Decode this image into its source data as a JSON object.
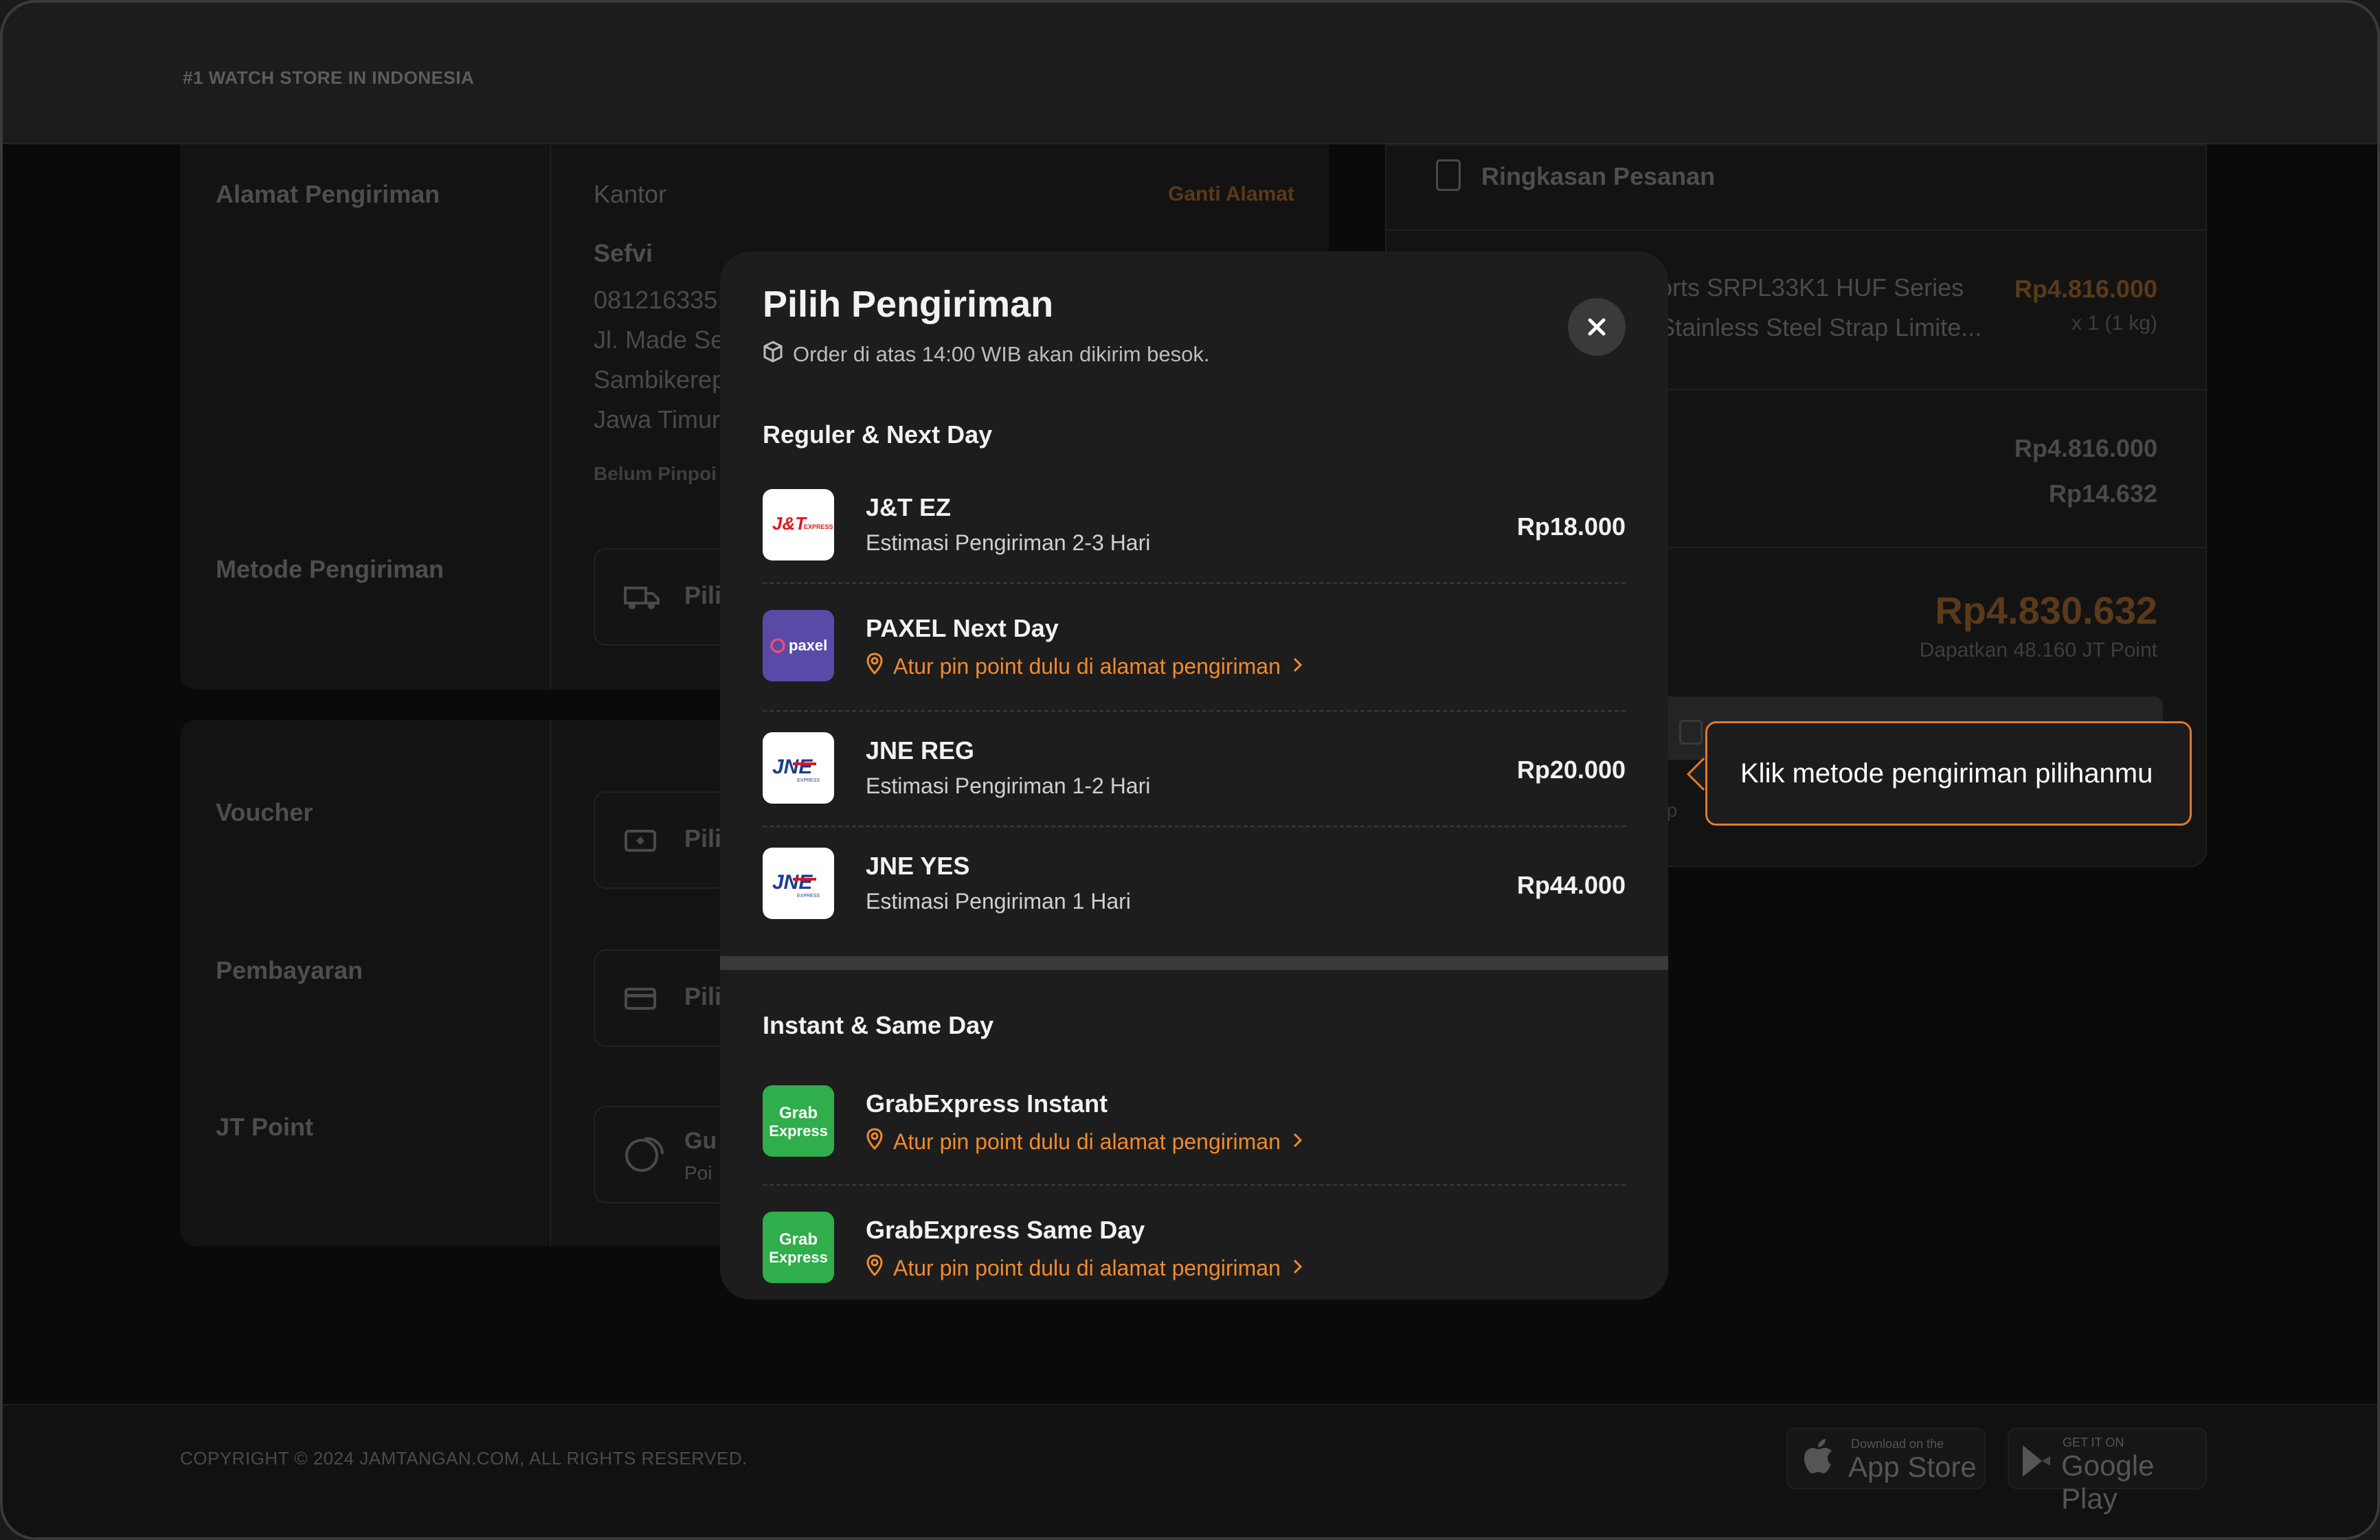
{
  "header": {
    "tagline": "#1 WATCH STORE IN INDONESIA"
  },
  "checkout": {
    "address_label": "Alamat Pengiriman",
    "address_type": "Kantor",
    "change_address": "Ganti Alamat",
    "recipient": "Sefvi",
    "phone_partial": "0812163351",
    "address_lines": [
      "Jl. Made Se",
      "Sambikerep",
      "Jawa Timur"
    ],
    "pinpoint_partial": "Belum Pinpoi",
    "shipping_label": "Metode Pengiriman",
    "shipping_pick": "Pili",
    "voucher_label": "Voucher",
    "voucher_pick": "Pili",
    "payment_label": "Pembayaran",
    "payment_pick": "Pili",
    "points_label": "JT Point",
    "points_pick_line1": "Gu",
    "points_pick_line2": "Poi"
  },
  "summary": {
    "title": "Ringkasan Pesanan",
    "product_line1": "orts SRPL33K1 HUF Series",
    "product_line2": "Stainless Steel Strap Limite...",
    "product_price": "Rp4.816.000",
    "product_qty": "x 1 (1 kg)",
    "subtotal": "Rp4.816.000",
    "fee": "Rp14.632",
    "total": "Rp4.830.632",
    "points_earned": "Dapatkan 48.160 JT Point",
    "hint_partial": "ih p"
  },
  "modal": {
    "title": "Pilih Pengiriman",
    "subtitle": "Order di atas 14:00 WIB akan dikirim besok.",
    "sections": [
      {
        "title": "Reguler & Next Day",
        "options": [
          {
            "name": "J&T EZ",
            "estimate": "Estimasi Pengiriman 2-3 Hari",
            "price": "Rp18.000",
            "logo_text": "J&T",
            "logo_sub": "EXPRESS"
          },
          {
            "name": "PAXEL Next Day",
            "warning": "Atur pin point dulu di alamat pengiriman",
            "logo_text": "paxel"
          },
          {
            "name": "JNE REG",
            "estimate": "Estimasi Pengiriman 1-2 Hari",
            "price": "Rp20.000",
            "logo_text": "JNE",
            "logo_sub": "EXPRESS"
          },
          {
            "name": "JNE YES",
            "estimate": "Estimasi Pengiriman 1 Hari",
            "price": "Rp44.000",
            "logo_text": "JNE",
            "logo_sub": "EXPRESS"
          }
        ]
      },
      {
        "title": "Instant & Same Day",
        "options": [
          {
            "name": "GrabExpress Instant",
            "warning": "Atur pin point dulu di alamat pengiriman",
            "logo_line1": "Grab",
            "logo_line2": "Express"
          },
          {
            "name": "GrabExpress Same Day",
            "warning": "Atur pin point dulu di alamat pengiriman",
            "logo_line1": "Grab",
            "logo_line2": "Express"
          }
        ]
      }
    ]
  },
  "tooltip": {
    "text": "Klik metode pengiriman pilihanmu"
  },
  "footer": {
    "copyright": "COPYRIGHT © 2024 JAMTANGAN.COM, ALL RIGHTS RESERVED.",
    "app_store_small": "Download on the",
    "app_store_big": "App Store",
    "google_play_small": "GET IT ON",
    "google_play_big": "Google Play"
  },
  "colors": {
    "accent": "#ef8a2e",
    "modal_bg": "#1d1d1d",
    "grab_green": "#2fae4b",
    "paxel_purple": "#5a4aa8",
    "jnt_red": "#e0161e",
    "jne_blue": "#1b3e8f"
  },
  "icons": [
    "package-icon",
    "close-icon",
    "location-pin-icon",
    "chevron-right-icon",
    "truck-icon",
    "ticket-icon",
    "card-icon",
    "coins-icon",
    "document-icon",
    "lock-icon",
    "apple-icon",
    "google-play-icon"
  ]
}
